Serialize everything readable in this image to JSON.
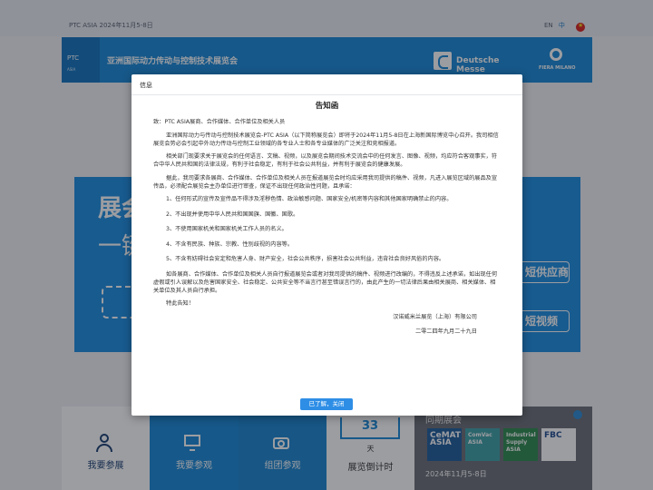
{
  "topbar": {
    "date": "PTC ASIA 2024年11月5-8日",
    "lang_en": "EN",
    "lang_cn": "中"
  },
  "header": {
    "logo_main": "PTC",
    "logo_sub": "ASIA",
    "title": "亚洲国际动力传动与控制技术展览会",
    "partner1": "Deutsche Messe",
    "partner2": "FIERA MILANO"
  },
  "hero": {
    "line1": "展会",
    "line2": "一键",
    "pill1": "短供应商",
    "pill2": "短视频"
  },
  "tiles": {
    "visit": "我要参展",
    "visit2": "我要参观",
    "group": "组团参观",
    "countdown_num": "33",
    "countdown_unit": "天",
    "countdown_label": "展览倒计时",
    "shows_title": "同期展会",
    "brand1": "CeMAT ASIA",
    "brand2": "ComVac ASIA",
    "brand3": "Industrial Supply ASIA",
    "brand4": "FBC",
    "shows_date": "2024年11月5-8日"
  },
  "modal": {
    "header": "信息",
    "title": "告知函",
    "salutation": "致：PTC ASIA展商、合作媒体、合作单位及相关人员",
    "para1": "亚洲国际动力与传动与控制技术展览会-PTC ASIA（以下简称展览会）即将于2024年11月5-8日在上海新国际博览中心召开。我司相信展览会势必会引起中外动力传动与控制工业领域的各专业人士和各专业媒体的广泛关注和竞相报道。",
    "para2": "相关部门现要求关于展览会的任何语言、文稿、视频，以及展览会期间技术交流会中的任何发言、图像、视频，均应符合客观事实，符合中华人民共和国的法律法规，有利于社会稳定，有利于社会公共利益，并有利于展览会的健康发展。",
    "para3": "据此，我司要求各展商、合作媒体、合作单位及相关人员在报道展览会时均应采用我司提供的稿件、视频，凡进入展览区域的展品及宣传品，必须配合展览会主办单位进行审查，保证不出现任何政治性问题，且承诺：",
    "items": [
      "1、任何形式的宣传及宣传品不得涉及淫秽色情、政治敏感问题、国家安全/机密等内容和其他国家明确禁止的内容。",
      "2、不出现并使用中华人民共和国国旗、国徽、国歌。",
      "3、不使用国家机关和国家机关工作人员的名义。",
      "4、不含有民族、种族、宗教、性别歧视的内容等。",
      "5、不含有妨碍社会安定和危害人身、财产安全，社会公共秩序，损害社会公共利益，违背社会良好风俗的内容。"
    ],
    "para4": "如各展商、合作媒体、合作单位及相关人员自行报道展览会或者对我司提供的稿件、视频进行改编的，不得违反上述承诺，如出现任何虚假或引人误解以及危害国家安全、社会稳定、公共安全等不当言行甚至错误言行的，由此产生的一切法律后果由相关展商、相关媒体、相关单位及其人员自行承担。",
    "closing": "特此告知！",
    "signature": "汉诺威米兰展览（上海）有限公司",
    "date": "二零二四年九月二十九日",
    "button": "已了解，关闭"
  }
}
